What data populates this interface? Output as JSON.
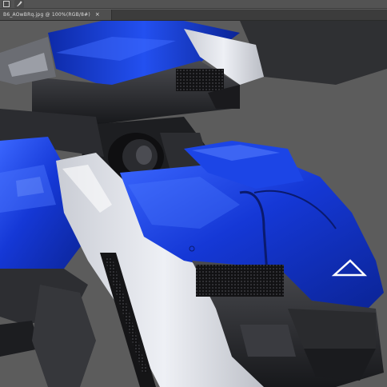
{
  "window": {
    "document_tab_label": "B6_AOwBRq.jpg @ 100%(RGB/8#)",
    "tab_close_glyph": "×"
  },
  "toolbar": {
    "icons": [
      "tool-preset-icon",
      "brush-settings-icon"
    ]
  },
  "canvas": {
    "background": "#5c5c5c",
    "artwork_description_colors": {
      "primary_blue": "#1538d6",
      "deep_blue": "#0b2496",
      "highlight_blue": "#3b67ff",
      "white_panel": "#e7e9ef",
      "dark_metal": "#232427",
      "mid_metal": "#3a3b3f"
    }
  }
}
